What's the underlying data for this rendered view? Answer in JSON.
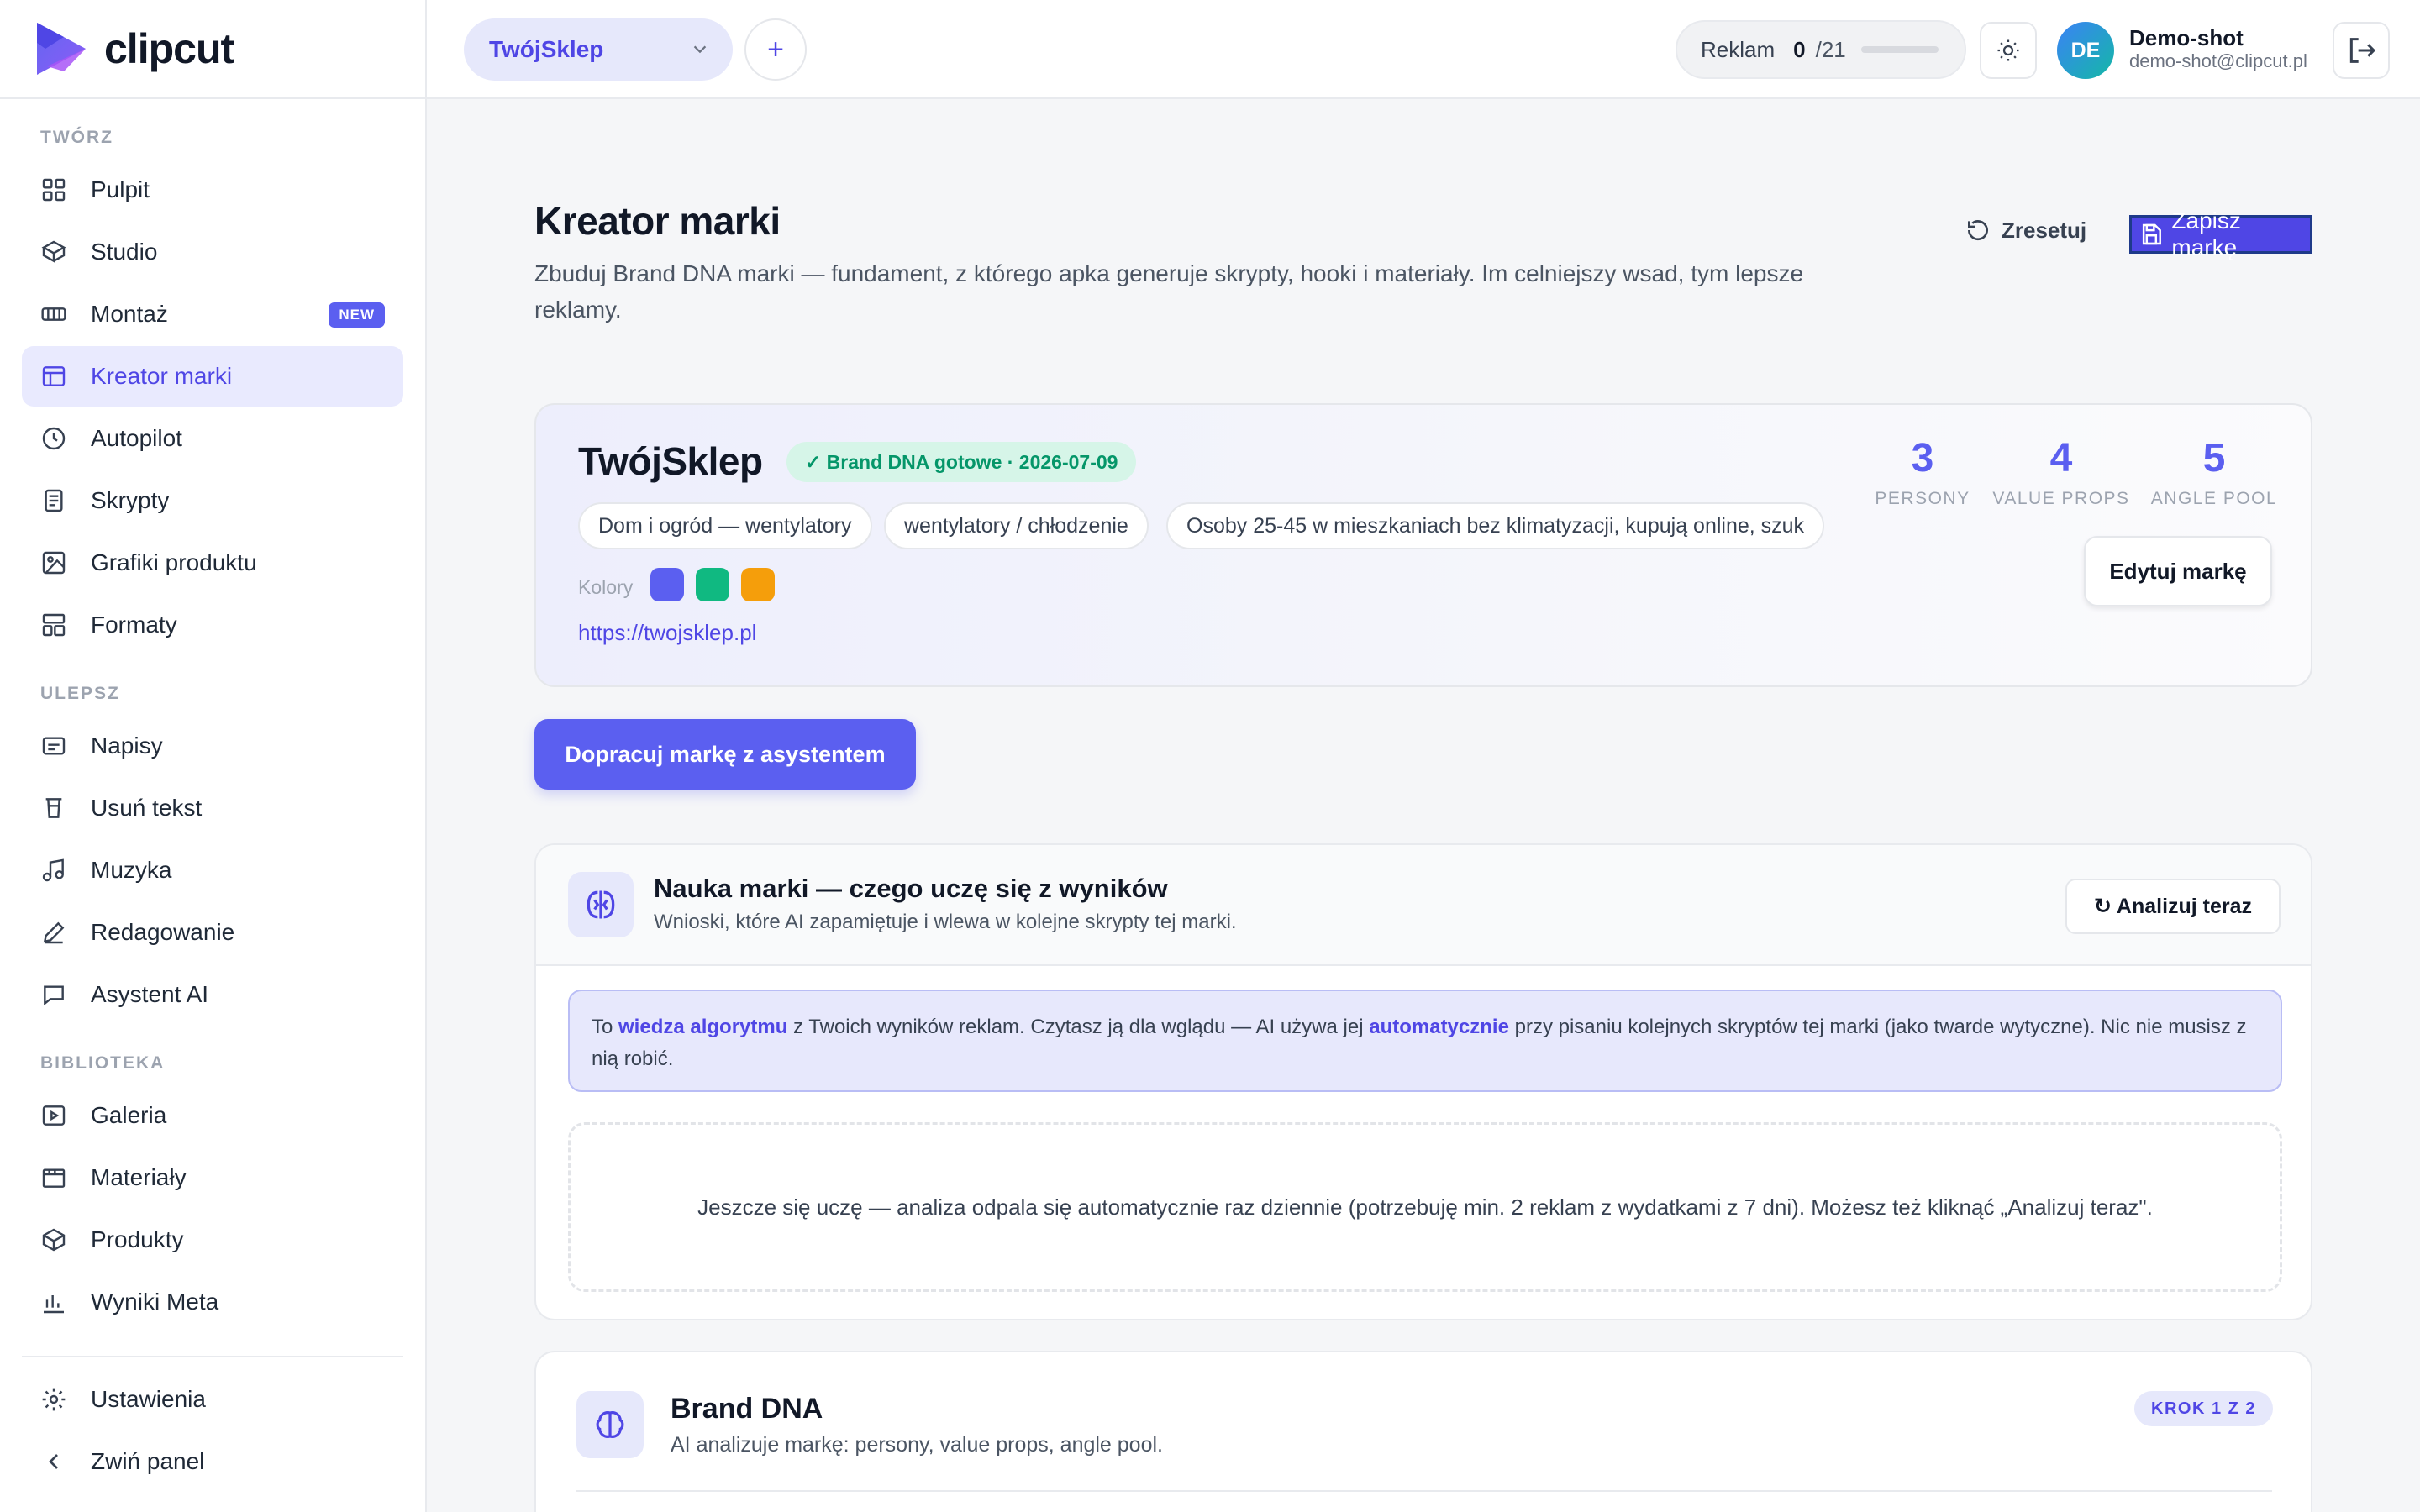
{
  "app": {
    "name": "clipcut"
  },
  "colors": {
    "accent": "#5b5ff0",
    "success": "#059669",
    "brand_colors": [
      "#5b5ff0",
      "#10b981",
      "#f59e0b"
    ]
  },
  "sidebar": {
    "sections": [
      {
        "label": "TWÓRZ",
        "items": [
          {
            "label": "Pulpit",
            "icon": "grid-icon"
          },
          {
            "label": "Studio",
            "icon": "cube-icon"
          },
          {
            "label": "Montaż",
            "icon": "film-strip-icon",
            "badge": "NEW"
          },
          {
            "label": "Kreator marki",
            "icon": "layout-icon",
            "active": true
          },
          {
            "label": "Autopilot",
            "icon": "clock-icon"
          },
          {
            "label": "Skrypty",
            "icon": "document-icon"
          },
          {
            "label": "Grafiki produktu",
            "icon": "image-icon"
          },
          {
            "label": "Formaty",
            "icon": "formats-icon"
          }
        ]
      },
      {
        "label": "ULEPSZ",
        "items": [
          {
            "label": "Napisy",
            "icon": "captions-icon"
          },
          {
            "label": "Usuń tekst",
            "icon": "eraser-icon"
          },
          {
            "label": "Muzyka",
            "icon": "music-icon"
          },
          {
            "label": "Redagowanie",
            "icon": "pen-icon"
          },
          {
            "label": "Asystent AI",
            "icon": "chat-icon"
          }
        ]
      },
      {
        "label": "BIBLIOTEKA",
        "items": [
          {
            "label": "Galeria",
            "icon": "play-square-icon"
          },
          {
            "label": "Materiały",
            "icon": "clapper-icon"
          },
          {
            "label": "Produkty",
            "icon": "box-icon"
          },
          {
            "label": "Wyniki Meta",
            "icon": "bar-chart-icon"
          }
        ]
      }
    ],
    "footer": [
      {
        "label": "Ustawienia",
        "icon": "gear-icon"
      },
      {
        "label": "Zwiń panel",
        "icon": "chevron-left-icon"
      }
    ]
  },
  "header": {
    "shop": "TwójSklep",
    "add": "+",
    "ads_label": "Reklam",
    "ads_count": "0",
    "ads_total": "/21",
    "ads_progress": 0,
    "user_initials": "DE",
    "user_name": "Demo-shot",
    "user_email": "demo-shot@clipcut.pl"
  },
  "page": {
    "title": "Kreator marki",
    "subtitle": "Zbuduj Brand DNA marki — fundament, z którego apka generuje skrypty, hooki i materiały. Im celniejszy wsad, tym lepsze reklamy.",
    "reset": "Zresetuj",
    "save": "Zapisz markę"
  },
  "brand": {
    "name": "TwójSklep",
    "badge": "✓ Brand DNA gotowe · 2026-07-09",
    "tags": [
      "Dom i ogród — wentylatory",
      "wentylatory / chłodzenie",
      "Osoby 25-45 w mieszkaniach bez klimatyzacji, kupują online, szuk"
    ],
    "colors_label": "Kolory",
    "url": "https://twojsklep.pl",
    "stats": [
      {
        "value": "3",
        "label": "PERSONY"
      },
      {
        "value": "4",
        "label": "VALUE PROPS"
      },
      {
        "value": "5",
        "label": "ANGLE POOL"
      }
    ],
    "edit": "Edytuj markę"
  },
  "assistant_button": "Dopracuj markę z asystentem",
  "learning": {
    "title": "Nauka marki — czego uczę się z wyników",
    "subtitle": "Wnioski, które AI zapamiętuje i wlewa w kolejne skrypty tej marki.",
    "analyze": "↻ Analizuj teraz",
    "info_1": "To ",
    "info_b1": "wiedza algorytmu",
    "info_2": " z Twoich wyników reklam. Czytasz ją dla wglądu — AI używa jej ",
    "info_b2": "automatycznie",
    "info_3": " przy pisaniu kolejnych skryptów tej marki (jako twarde wytyczne). Nic nie musisz z nią robić.",
    "empty": "Jeszcze się uczę — analiza odpala się automatycznie raz dziennie (potrzebuję min. 2 reklam z wydatkami z 7 dni). Możesz też kliknąć „Analizuj teraz\"."
  },
  "dna": {
    "title": "Brand DNA",
    "subtitle": "AI analizuje markę: persony, value props, angle pool.",
    "step": "KROK 1 Z 2"
  }
}
